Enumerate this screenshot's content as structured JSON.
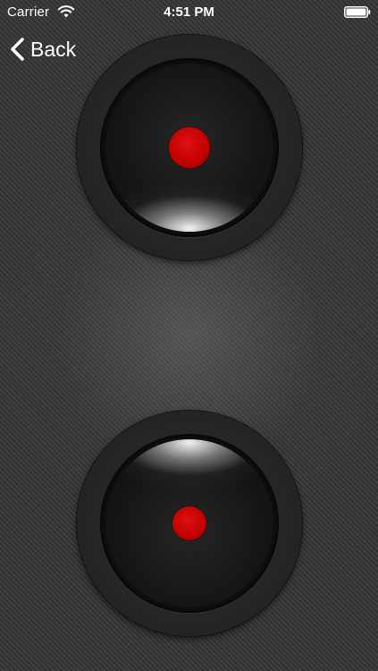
{
  "status_bar": {
    "carrier": "Carrier",
    "time": "4:51 PM",
    "icons": [
      "wifi-icon",
      "battery-icon"
    ]
  },
  "nav": {
    "back_label": "Back",
    "back_icon": "chevron-left-icon"
  },
  "knobs": [
    {
      "id": "top",
      "indicator_color": "#c00000",
      "highlight": "bottom"
    },
    {
      "id": "bottom",
      "indicator_color": "#c00000",
      "highlight": "top"
    }
  ],
  "colors": {
    "background": "#3a3a3a",
    "indicator": "#c00000",
    "text": "#ffffff"
  }
}
